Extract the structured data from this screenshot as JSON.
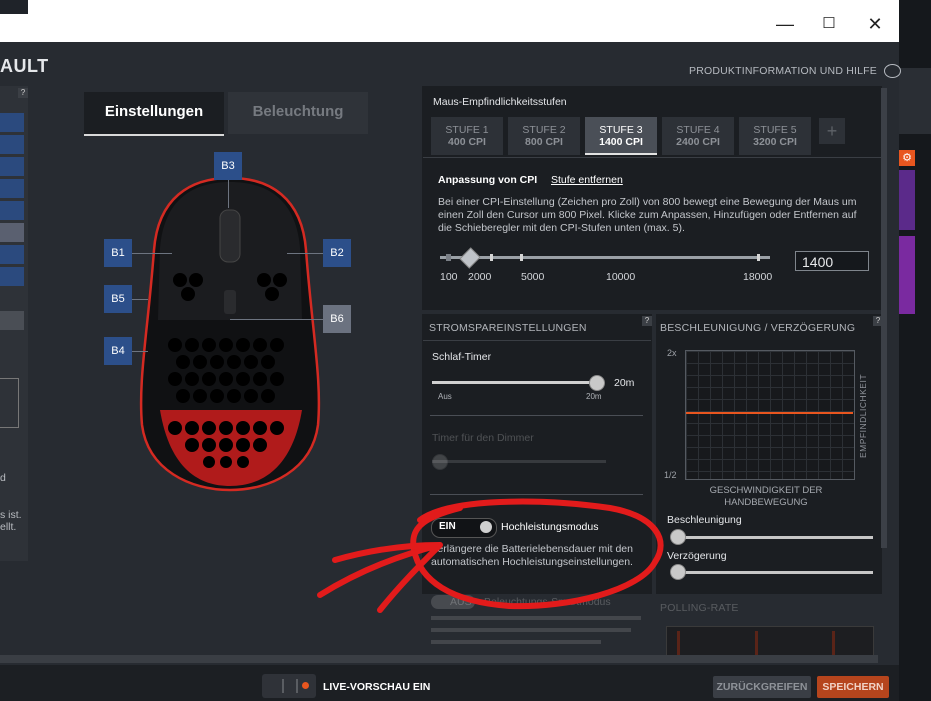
{
  "window": {
    "minimize_glyph": "—",
    "maximize_glyph": "☐",
    "close_glyph": "✕"
  },
  "header": {
    "title_fragment": "AULT",
    "product_info": "PRODUKTINFORMATION UND HILFE"
  },
  "tabs": [
    {
      "label": "Einstellungen",
      "active": true
    },
    {
      "label": "Beleuchtung",
      "active": false
    }
  ],
  "buttons_on_mouse": [
    "B3",
    "B1",
    "B2",
    "B5",
    "B6",
    "B4"
  ],
  "left_panel": {
    "help_glyph": "?",
    "fragments": [
      "d",
      "s ist.",
      "ellt."
    ]
  },
  "cpi": {
    "section_title": "Maus-Empfindlichkeitsstufen",
    "stages": [
      {
        "label": "STUFE 1",
        "value": "400 CPI"
      },
      {
        "label": "STUFE 2",
        "value": "800 CPI"
      },
      {
        "label": "STUFE 3",
        "value": "1400 CPI",
        "active": true
      },
      {
        "label": "STUFE 4",
        "value": "2400 CPI"
      },
      {
        "label": "STUFE 5",
        "value": "3200 CPI"
      }
    ],
    "add_glyph": "+",
    "adjust_label": "Anpassung von CPI",
    "remove_link": "Stufe entfernen",
    "description": "Bei einer CPI-Einstellung (Zeichen pro Zoll) von 800 bewegt eine Bewegung der Maus um einen Zoll den Cursor um 800 Pixel. Klicke zum Anpassen, Hinzufügen oder Entfernen auf die Schieberegler mit den CPI-Stufen unten (max. 5).",
    "ticks": [
      "100",
      "2000",
      "5000",
      "10000",
      "18000"
    ],
    "input_value": "1400"
  },
  "power": {
    "title": "STROMSPAREINSTELLUNGEN",
    "sleep_label": "Schlaf-Timer",
    "sleep_value": "20m",
    "sleep_min": "Aus",
    "sleep_max": "20m",
    "dimmer_label": "Timer für den Dimmer",
    "toggle_on": "EIN",
    "hp_label": "Hochleistungsmodus",
    "hp_desc": "Verlängere die Batterielebensdauer mit den automatischen Hochleistungseinstellungen.",
    "toggle_off": "AUS",
    "smart_label": "Beleuchtungs-Smartmodus"
  },
  "accel": {
    "title": "BESCHLEUNIGUNG / VERZÖGERUNG",
    "y_top": "2x",
    "y_bottom": "1/2",
    "y_axis": "EMPFINDLICHKEIT",
    "x_axis": "GESCHWINDIGKEIT DER HANDBEWEGUNG",
    "accel_label": "Beschleunigung",
    "decel_label": "Verzögerung",
    "polling_title": "POLLING-RATE"
  },
  "footer": {
    "live_preview": "LIVE-VORSCHAU EIN",
    "revert": "ZURÜCKGREIFEN",
    "save": "SPEICHERN"
  },
  "colors": {
    "accent": "#e8561f",
    "annotation_red": "#e21b1b",
    "button_blue": "#2c4f8a"
  }
}
